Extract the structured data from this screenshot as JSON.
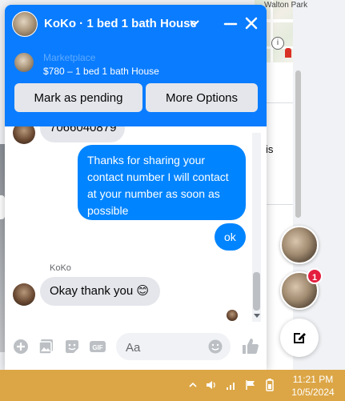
{
  "chat": {
    "title": "KoKo · 1 bed 1 bath House",
    "marketplace": {
      "label": "Marketplace",
      "listing": "$780 – 1 bed 1 bath House"
    },
    "buttons": {
      "mark_pending": "Mark as pending",
      "more_options": "More Options"
    },
    "messages": [
      {
        "from": "KoKo",
        "direction": "incoming",
        "text": "7066040879"
      },
      {
        "from": "me",
        "direction": "outgoing",
        "text": "Thanks for sharing your contact number I will contact at your number as soon as possible"
      },
      {
        "from": "me",
        "direction": "outgoing",
        "text": "ok"
      },
      {
        "from": "KoKo",
        "direction": "incoming",
        "sender_label": "KoKo",
        "text": "Okay thank you 😊"
      }
    ],
    "composer": {
      "placeholder": "Aa"
    }
  },
  "background": {
    "map_label": "Walton Park",
    "partial_text": "is"
  },
  "chat_heads": {
    "unread_badge": "1"
  },
  "taskbar": {
    "time": "11:21 PM",
    "date": "10/5/2024"
  },
  "colors": {
    "messenger_blue": "#0a7cff",
    "outgoing_bubble": "#0084ff",
    "incoming_bubble": "#e4e6eb",
    "badge_red": "#e41e3f",
    "taskbar": "#dca646"
  }
}
